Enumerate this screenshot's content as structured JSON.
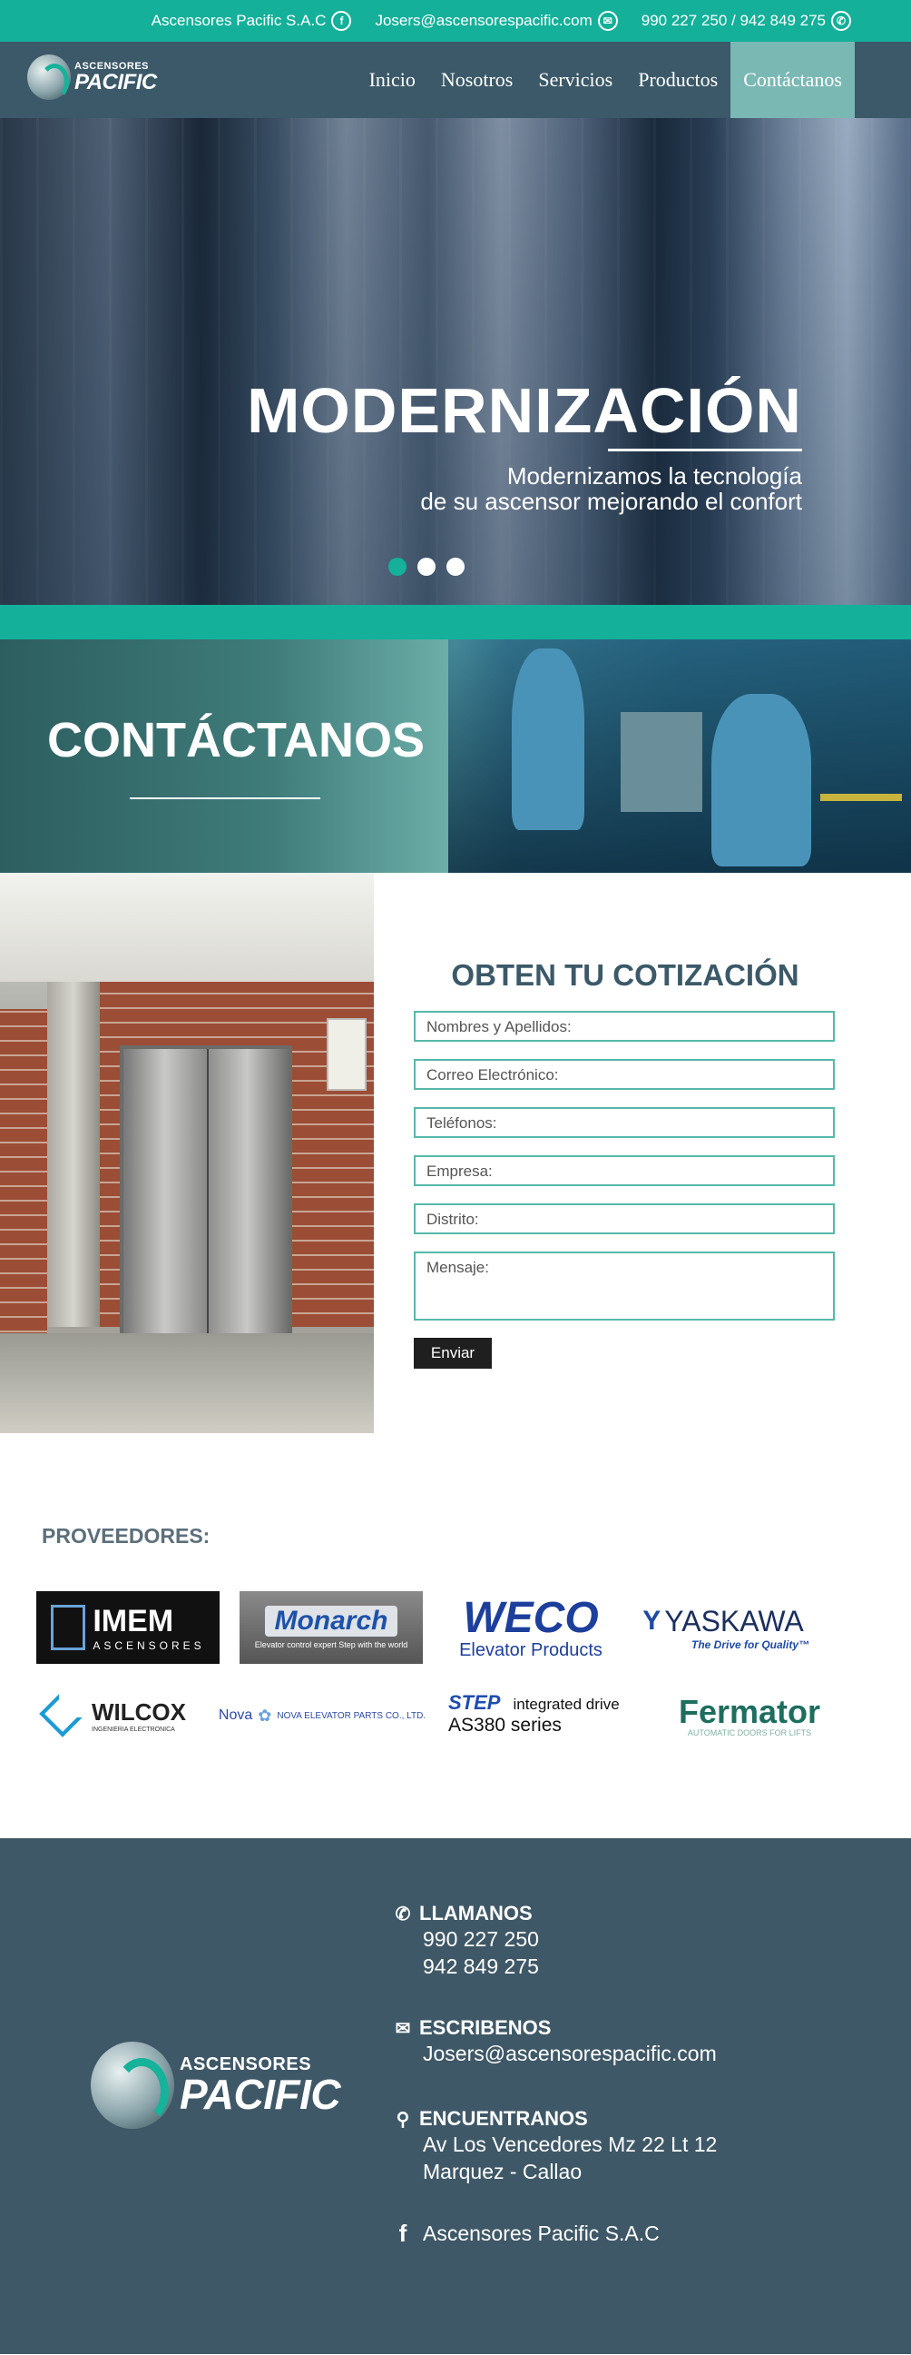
{
  "topbar": {
    "company": "Ascensores Pacific S.A.C",
    "email": "Josers@ascensorespacific.com",
    "phones": "990 227 250 / 942 849 275",
    "facebook_icon": "facebook-icon",
    "mail_icon": "mail-icon",
    "phone_icon": "phone-icon"
  },
  "logo": {
    "small": "ASCENSORES",
    "big": "PACIFIC"
  },
  "nav": {
    "items": [
      {
        "label": "Inicio"
      },
      {
        "label": "Nosotros"
      },
      {
        "label": "Servicios"
      },
      {
        "label": "Productos"
      },
      {
        "label": "Contáctanos"
      }
    ],
    "active": "Contáctanos"
  },
  "hero": {
    "title": "MODERNIZACIÓN",
    "subtitle_line1": "Modernizamos la tecnología",
    "subtitle_line2": "de su ascensor mejorando el confort",
    "active_slide": 1,
    "slide_count": 3
  },
  "banner": {
    "title": "CONTÁCTANOS"
  },
  "form": {
    "title": "OBTEN TU COTIZACIÓN",
    "name_placeholder": "Nombres y Apellidos:",
    "email_placeholder": "Correo Electrónico:",
    "phone_placeholder": "Teléfonos:",
    "company_placeholder": "Empresa:",
    "district_placeholder": "Distrito:",
    "message_placeholder": "Mensaje:",
    "submit_label": "Enviar"
  },
  "providers": {
    "title": "PROVEEDORES:",
    "logos": {
      "imem": {
        "name": "IMEM",
        "sub": "ASCENSORES"
      },
      "monarch": {
        "name": "Monarch",
        "sub": "Elevator control expert Step with the world"
      },
      "weco": {
        "name": "WECO",
        "sub": "Elevator Products"
      },
      "yaskawa": {
        "name": "YASKAWA",
        "sub": "The Drive for Quality™"
      },
      "wilcox": {
        "name": "WILCOX",
        "sub": "INGENIERIA ELECTRONICA"
      },
      "nova": {
        "name": "Nova",
        "sub": "NOVA ELEVATOR PARTS CO., LTD."
      },
      "step": {
        "name": "STEP",
        "tag": "integrated drive",
        "sub": "AS380 series"
      },
      "fermator": {
        "name": "Fermator",
        "sub": "AUTOMATIC DOORS FOR LIFTS"
      }
    }
  },
  "footer": {
    "call_title": "LLAMANOS",
    "phone1": "990 227 250",
    "phone2": "942 849 275",
    "write_title": "ESCRIBENOS",
    "email": "Josers@ascensorespacific.com",
    "find_title": "ENCUENTRANOS",
    "address1": "Av Los Vencedores Mz 22 Lt 12",
    "address2": "Marquez - Callao",
    "facebook": "Ascensores Pacific S.A.C"
  },
  "colors": {
    "accent": "#14b09a",
    "nav": "#3b5968",
    "footer": "#3f5867"
  }
}
